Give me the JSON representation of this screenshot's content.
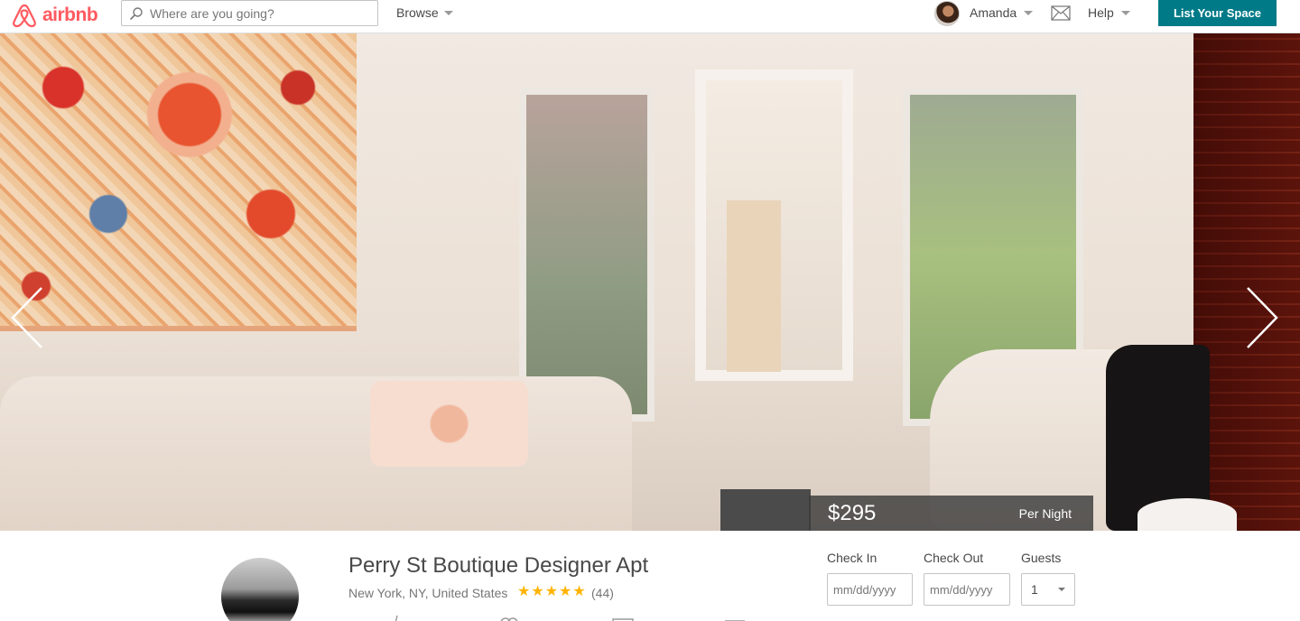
{
  "header": {
    "logo_text": "airbnb",
    "search_placeholder": "Where are you going?",
    "browse_label": "Browse",
    "user_name": "Amanda",
    "help_label": "Help",
    "list_space_label": "List Your Space"
  },
  "hero": {
    "price": "$295",
    "price_period": "Per Night"
  },
  "listing": {
    "title": "Perry St Boutique Designer Apt",
    "location": "New York, NY, United States",
    "rating_stars": 5,
    "review_count": "(44)"
  },
  "booking": {
    "check_in_label": "Check In",
    "check_in_placeholder": "mm/dd/yyyy",
    "check_out_label": "Check Out",
    "check_out_placeholder": "mm/dd/yyyy",
    "guests_label": "Guests",
    "guests_value": "1"
  },
  "colors": {
    "brand": "#ff5a5f",
    "accent_button": "#007a87",
    "star": "#ffb400"
  }
}
